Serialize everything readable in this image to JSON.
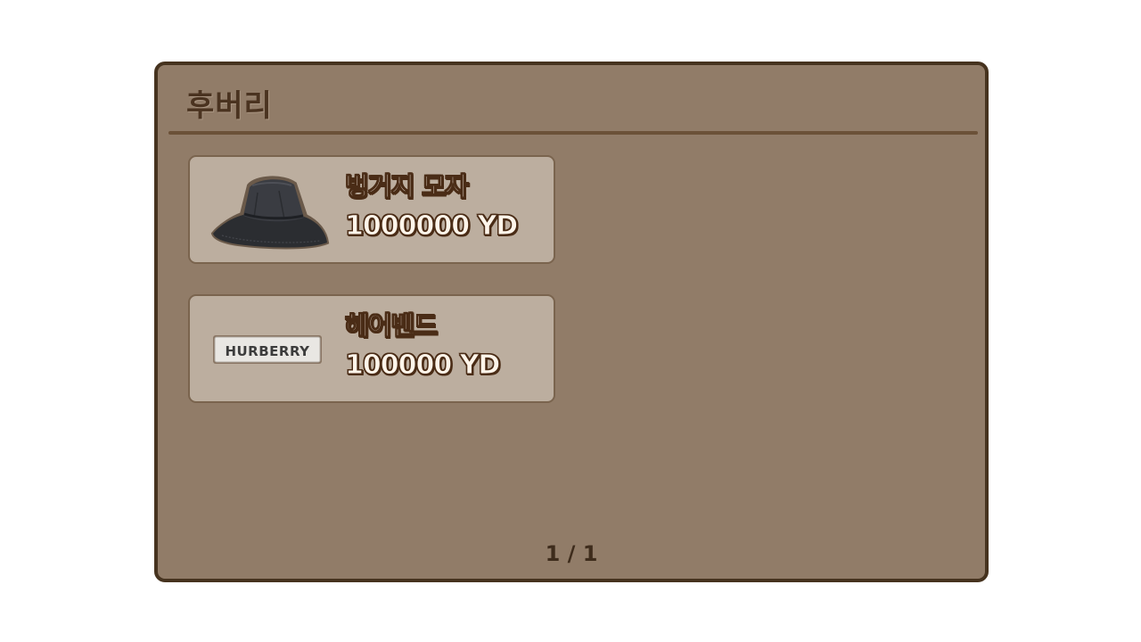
{
  "shop": {
    "title": "후버리",
    "items": [
      {
        "name": "벙거지 모자",
        "price": "1000000 YD",
        "icon": "bucket-hat-icon"
      },
      {
        "name": "헤어밴드",
        "price": "100000 YD",
        "icon": "headband-icon",
        "icon_text": "HURBERRY"
      }
    ],
    "pager": "1 / 1"
  },
  "colors": {
    "panel_bg": "#917c68",
    "panel_border": "#46331f",
    "card_bg": "#bcae9f",
    "title_text": "#4a3320",
    "item_text_fill": "#fff5ea",
    "item_text_outline": "#4a2c16"
  }
}
